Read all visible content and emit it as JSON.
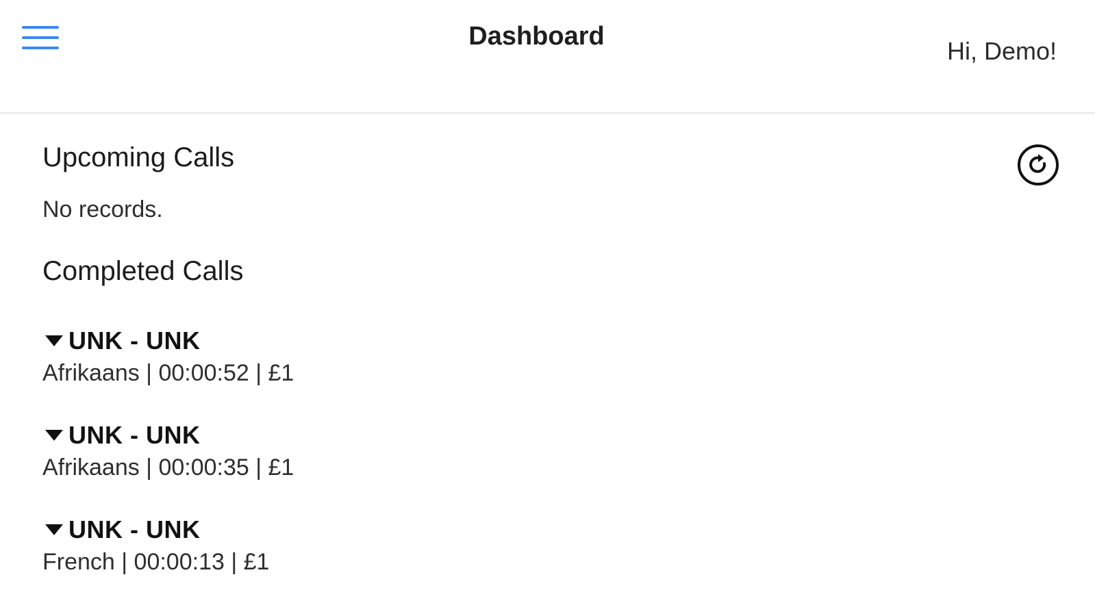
{
  "header": {
    "menu_icon": "hamburger-menu-icon",
    "title": "Dashboard",
    "greeting": "Hi, Demo!"
  },
  "upcoming": {
    "title": "Upcoming Calls",
    "empty_text": "No records.",
    "refresh_icon": "refresh-icon"
  },
  "completed": {
    "title": "Completed Calls",
    "calls": [
      {
        "title": "UNK - UNK",
        "details": "Afrikaans | 00:00:52 | £1"
      },
      {
        "title": "UNK - UNK",
        "details": "Afrikaans | 00:00:35 | £1"
      },
      {
        "title": "UNK - UNK",
        "details": "French | 00:00:13 | £1"
      }
    ]
  },
  "colors": {
    "accent": "#3b86f6",
    "text": "#1a1a1a",
    "divider": "#e8e8e8"
  }
}
